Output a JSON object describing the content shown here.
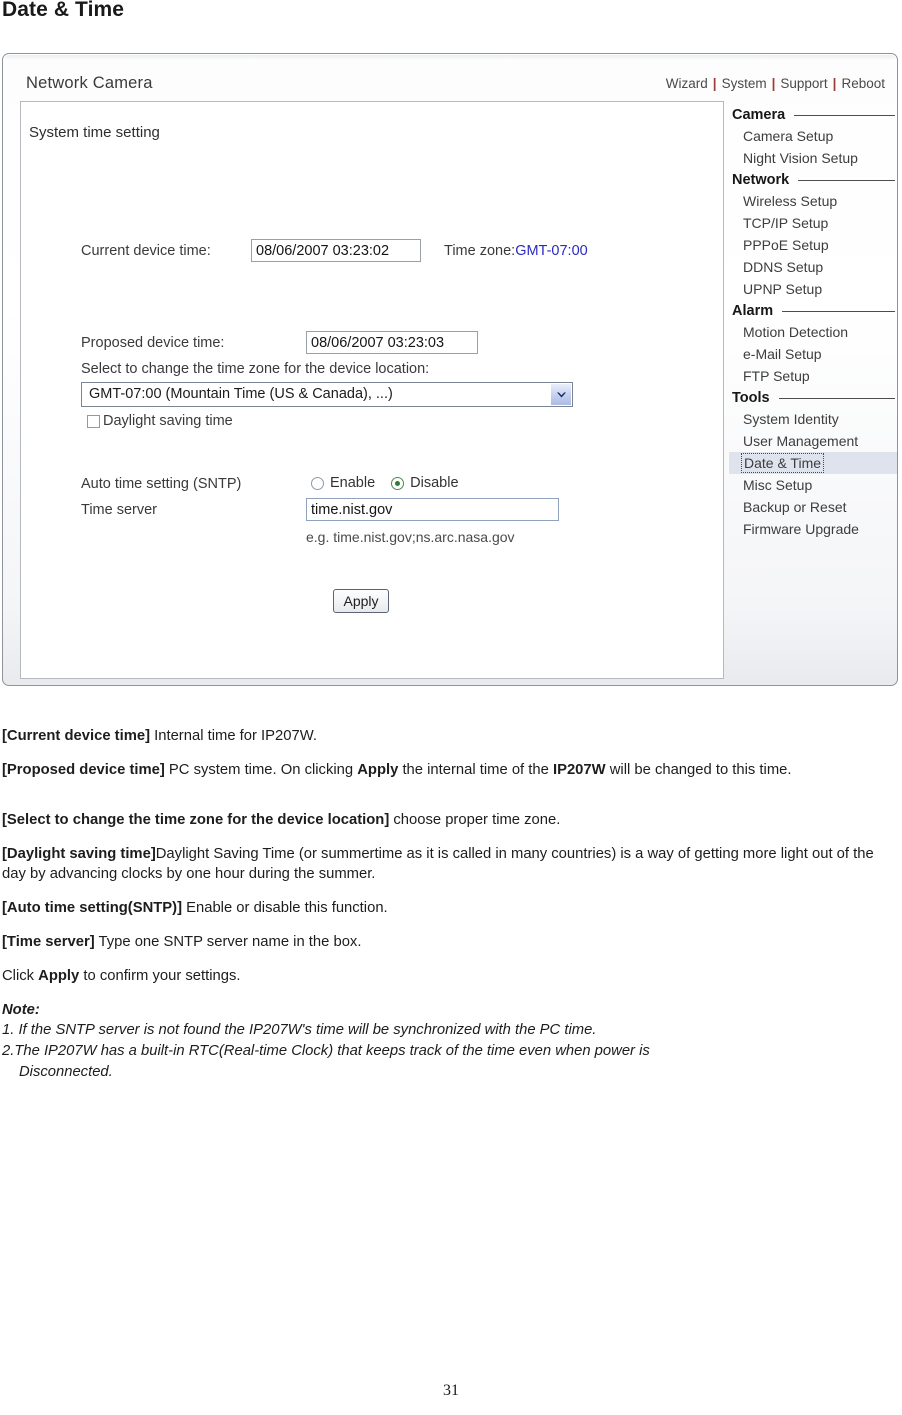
{
  "page": {
    "title": "Date & Time",
    "number": "31"
  },
  "device_ui": {
    "brand": "Network Camera",
    "topnav": {
      "items": [
        "Wizard",
        "System",
        "Support",
        "Reboot"
      ],
      "separator": "|"
    },
    "section_title": "System time setting",
    "fields": {
      "current_device_time_label": "Current device time:",
      "current_device_time_value": "08/06/2007 03:23:02",
      "time_zone_label": "Time zone:",
      "time_zone_value": "GMT-07:00",
      "proposed_device_time_label": "Proposed device time:",
      "proposed_device_time_value": "08/06/2007 03:23:03",
      "select_timezone_label": "Select to change the time zone for the device location:",
      "timezone_selected_option": "GMT-07:00 (Mountain Time (US & Canada), ...)",
      "daylight_saving_label": "Daylight saving time",
      "daylight_saving_checked": false,
      "sntp_label": "Auto time setting (SNTP)",
      "sntp_enable_label": "Enable",
      "sntp_disable_label": "Disable",
      "sntp_selected": "Disable",
      "time_server_label": "Time server",
      "time_server_value": "time.nist.gov",
      "time_server_hint": "e.g. time.nist.gov;ns.arc.nasa.gov"
    },
    "apply_label": "Apply",
    "sidebar": {
      "groups": [
        {
          "name": "Camera",
          "items": [
            "Camera Setup",
            "Night Vision Setup"
          ]
        },
        {
          "name": "Network",
          "items": [
            "Wireless Setup",
            "TCP/IP Setup",
            "PPPoE Setup",
            "DDNS Setup",
            "UPNP Setup"
          ]
        },
        {
          "name": "Alarm",
          "items": [
            "Motion Detection",
            "e-Mail Setup",
            "FTP Setup"
          ]
        },
        {
          "name": "Tools",
          "items": [
            "System Identity",
            "User Management",
            "Date & Time",
            "Misc Setup",
            "Backup or Reset",
            "Firmware Upgrade"
          ]
        }
      ],
      "selected_item": "Date & Time"
    },
    "colors": {
      "timezone_value": "#2a2ac0",
      "selected_item_background": "#dee3ed",
      "radio_selected": "#2e7d32",
      "topnav_separator": "#a03b3b"
    }
  },
  "doc": {
    "p1_bold": "[Current device time]",
    "p1_rest": " Internal time for IP207W.",
    "p2_bold": "[Proposed device time]",
    "p2_a": " PC system time. On clicking ",
    "p2_b1": "Apply",
    "p2_b": " the internal time of the ",
    "p2_b2": "IP207W",
    "p2_c": " will be changed to this time.",
    "p3_bold": "[Select to change the time zone for the device location]",
    "p3_rest": " choose proper time zone.",
    "p4_bold": "[Daylight saving time]",
    "p4_rest": "Daylight Saving Time (or summertime as it is called in many countries) is a way of getting more light out of the day by advancing clocks by one hour during the summer.",
    "p5_bold": "[Auto time setting(SNTP)]",
    "p5_rest": " Enable or disable this function.",
    "p6_bold": "[Time server]",
    "p6_rest": " Type one SNTP server name in the box.",
    "p7_a": "Click ",
    "p7_b": "Apply",
    "p7_c": " to confirm your settings.",
    "note_heading": "Note:",
    "note_1": "1. If the SNTP server is not found the IP207W's time will be synchronized with the PC time.",
    "note_2": "2.The IP207W has a built-in RTC(Real-time Clock) that keeps track of the time even when power is",
    "note_2b": "Disconnected."
  }
}
